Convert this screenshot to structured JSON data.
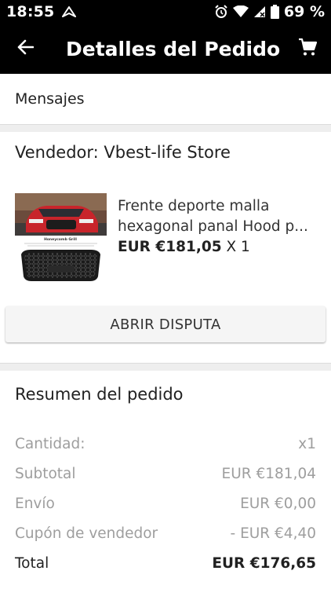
{
  "status_bar": {
    "time": "18:55",
    "battery_percent": "69 %"
  },
  "toolbar": {
    "title": "Detalles del Pedido",
    "back_icon": "arrow-back-icon",
    "cart_icon": "shopping-cart-icon"
  },
  "messages": {
    "label": "Mensajes"
  },
  "seller": {
    "name": "Vendedor: Vbest-life Store"
  },
  "product": {
    "title": "Frente deporte malla hexagonal panal Hood p...",
    "price": "EUR €181,05",
    "quantity": "X 1",
    "image_caption": "Honeycomb Grill"
  },
  "dispute_button": {
    "label": "ABRIR DISPUTA"
  },
  "summary": {
    "title": "Resumen del pedido",
    "rows": [
      {
        "label": "Cantidad:",
        "value": "x1"
      },
      {
        "label": "Subtotal",
        "value": "EUR €181,04"
      },
      {
        "label": "Envío",
        "value": "EUR €0,00"
      },
      {
        "label": "Cupón de vendedor",
        "value": "- EUR €4,40"
      },
      {
        "label": "Total",
        "value": "EUR €176,65"
      }
    ]
  },
  "colors": {
    "toolbar_bg": "#000000",
    "divider_bg": "#eeeeee",
    "muted_text": "#9e9e9e"
  }
}
